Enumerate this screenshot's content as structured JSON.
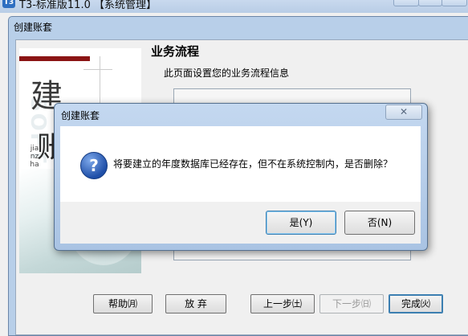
{
  "app": {
    "title": "T3-标准版11.0 【系统管理】",
    "icon_glyph": "T3"
  },
  "wizard": {
    "title": "创建账套",
    "page_title": "业务流程",
    "page_desc": "此页面设置您的业务流程信息",
    "side_brush_1": "建",
    "side_brush_2": "账",
    "side_vertical": "jianzhang",
    "buttons": {
      "help": "帮助㈪",
      "abandon": "放 弃",
      "prev": "上一步㈯",
      "next": "下一步㈰",
      "finish": "完成㈫"
    }
  },
  "dialog": {
    "title": "创建账套",
    "close_glyph": "✕",
    "icon_glyph": "?",
    "message": "将要建立的年度数据库已经存在，但不在系统控制内，是否删除？",
    "yes": "是(Y)",
    "no": "否(N)"
  },
  "colors": {
    "accent_bar": "#8b1414",
    "titlebar": "#b8cfe9",
    "question_icon": "#1f4fa8"
  }
}
